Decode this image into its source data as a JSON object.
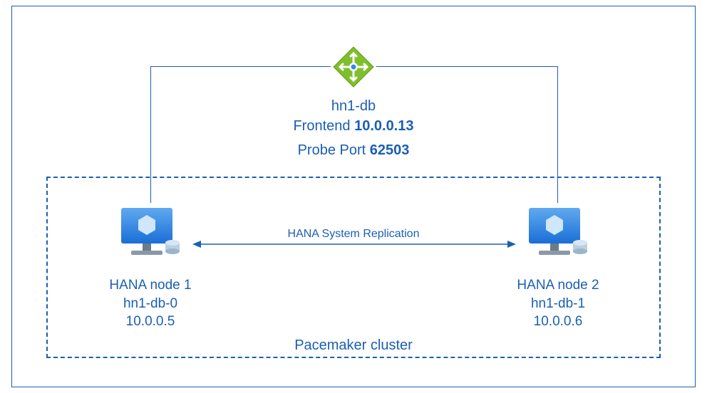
{
  "load_balancer": {
    "name": "hn1-db",
    "frontend_label": "Frontend",
    "frontend_ip": "10.0.0.13",
    "probe_label": "Probe Port",
    "probe_port": "62503"
  },
  "cluster": {
    "label": "Pacemaker cluster",
    "replication_label": "HANA System Replication"
  },
  "nodes": {
    "node1": {
      "title": "HANA node 1",
      "hostname": "hn1-db-0",
      "ip": "10.0.0.5"
    },
    "node2": {
      "title": "HANA node 2",
      "hostname": "hn1-db-1",
      "ip": "10.0.0.6"
    }
  }
}
